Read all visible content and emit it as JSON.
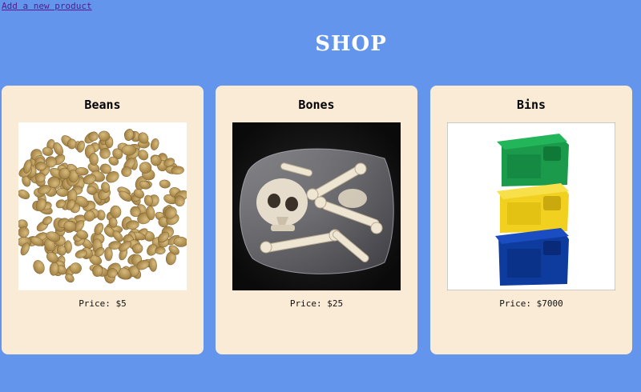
{
  "nav": {
    "add_product_link": "Add a new product"
  },
  "page": {
    "title": "SHOP"
  },
  "products": [
    {
      "name": "Beans",
      "price": "Price: $5",
      "image_icon": "lentils-image"
    },
    {
      "name": "Bones",
      "price": "Price: $25",
      "image_icon": "bones-bag-image"
    },
    {
      "name": "Bins",
      "price": "Price: $7000",
      "image_icon": "stacked-bins-image"
    }
  ],
  "colors": {
    "background": "#6495ED",
    "card": "#FAEBD7",
    "link": "#551A8B"
  }
}
